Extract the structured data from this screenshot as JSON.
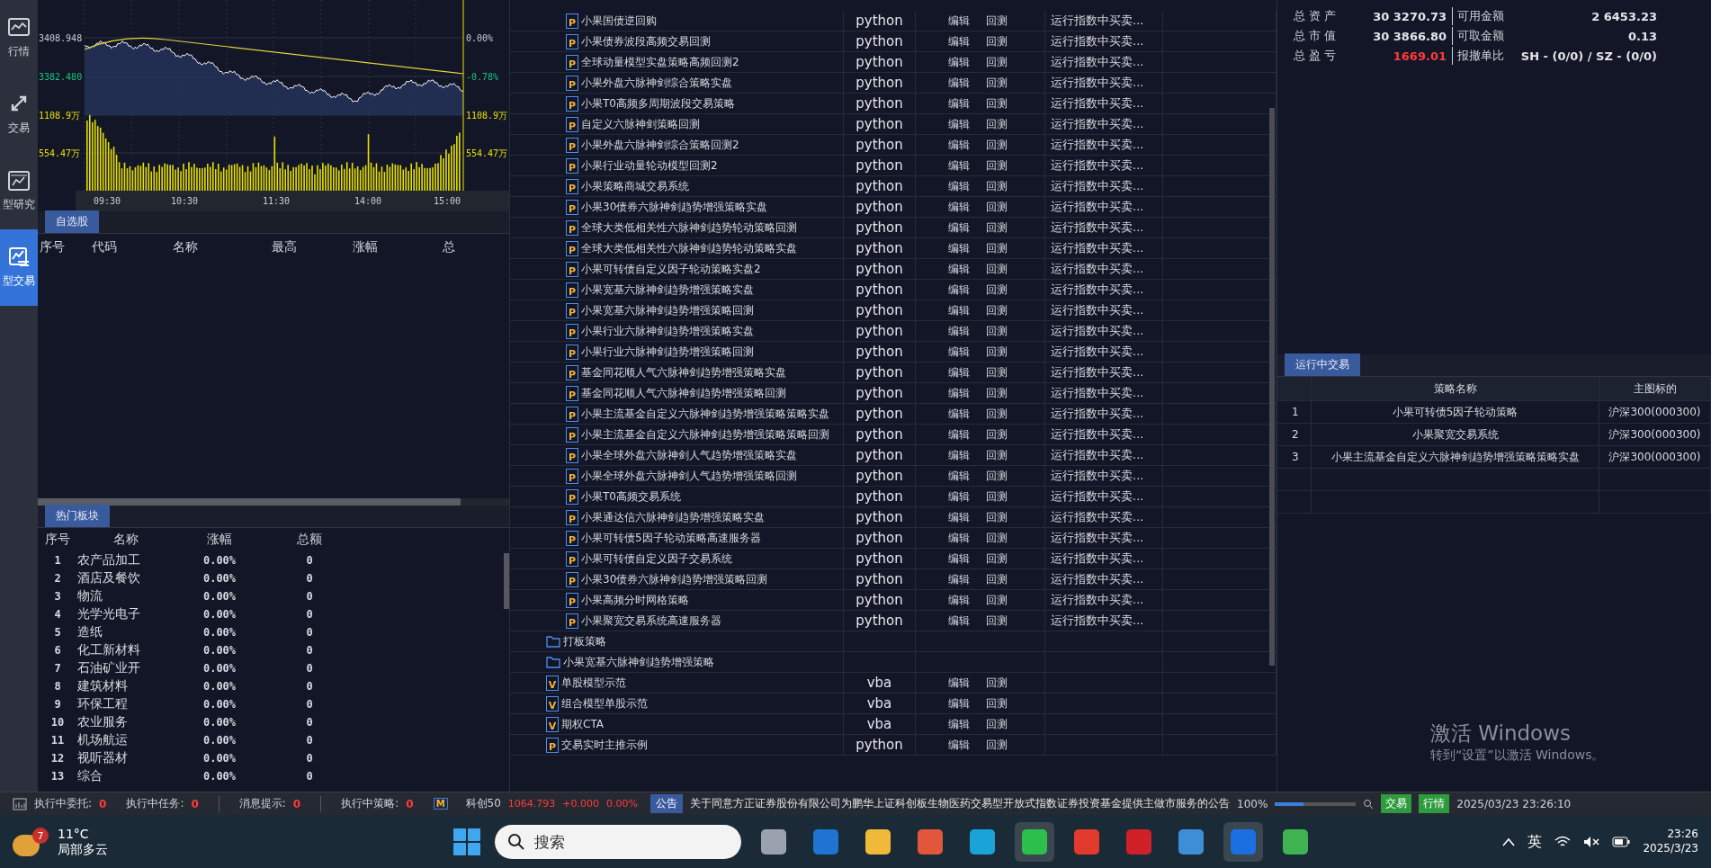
{
  "nav": [
    {
      "label": "行情",
      "selected": false
    },
    {
      "label": "交易",
      "selected": false
    },
    {
      "label": "型研究",
      "selected": false
    },
    {
      "label": "型交易",
      "selected": true
    }
  ],
  "index_chart": {
    "left_ticks": [
      "3408.948",
      "3382.480",
      "1108.9万",
      "554.47万"
    ],
    "right_ticks": [
      "0.00%",
      "-0.78%",
      "1108.9万",
      "554.47万"
    ],
    "times": [
      "09:30",
      "10:30",
      "11:30",
      "14:00",
      "15:00"
    ]
  },
  "watchlist": {
    "tab": "自选股",
    "columns": [
      "序号",
      "代码",
      "名称",
      "最高",
      "涨幅",
      "总"
    ]
  },
  "hot_sectors": {
    "tab": "热门板块",
    "columns": [
      "序号",
      "名称",
      "涨幅",
      "总额"
    ],
    "rows": [
      {
        "no": "1",
        "name": "农产品加工",
        "change": "0.00%",
        "total": "0"
      },
      {
        "no": "2",
        "name": "酒店及餐饮",
        "change": "0.00%",
        "total": "0"
      },
      {
        "no": "3",
        "name": "物流",
        "change": "0.00%",
        "total": "0"
      },
      {
        "no": "4",
        "name": "光学光电子",
        "change": "0.00%",
        "total": "0"
      },
      {
        "no": "5",
        "name": "造纸",
        "change": "0.00%",
        "total": "0"
      },
      {
        "no": "6",
        "name": "化工新材料",
        "change": "0.00%",
        "total": "0"
      },
      {
        "no": "7",
        "name": "石油矿业开",
        "change": "0.00%",
        "total": "0"
      },
      {
        "no": "8",
        "name": "建筑材料",
        "change": "0.00%",
        "total": "0"
      },
      {
        "no": "9",
        "name": "环保工程",
        "change": "0.00%",
        "total": "0"
      },
      {
        "no": "10",
        "name": "农业服务",
        "change": "0.00%",
        "total": "0"
      },
      {
        "no": "11",
        "name": "机场航运",
        "change": "0.00%",
        "total": "0"
      },
      {
        "no": "12",
        "name": "视听器材",
        "change": "0.00%",
        "total": "0"
      },
      {
        "no": "13",
        "name": "综合",
        "change": "0.00%",
        "total": "0"
      }
    ]
  },
  "strategies": [
    {
      "kind": "group",
      "children": [
        {
          "kind": "script",
          "badge": "P",
          "name": "小果国债逆回购",
          "lang": "python",
          "actions": [
            "编辑",
            "回测"
          ],
          "status": "运行指数中买卖..."
        },
        {
          "kind": "script",
          "badge": "P",
          "name": "小果债券波段高频交易回测",
          "lang": "python",
          "actions": [
            "编辑",
            "回测"
          ],
          "status": "运行指数中买卖..."
        },
        {
          "kind": "script",
          "badge": "P",
          "name": "全球动量模型实盘策略高频回测2",
          "lang": "python",
          "actions": [
            "编辑",
            "回测"
          ],
          "status": "运行指数中买卖..."
        },
        {
          "kind": "script",
          "badge": "P",
          "name": "小果外盘六脉神剑综合策略实盘",
          "lang": "python",
          "actions": [
            "编辑",
            "回测"
          ],
          "status": "运行指数中买卖..."
        },
        {
          "kind": "script",
          "badge": "P",
          "name": "小果T0高频多周期波段交易策略",
          "lang": "python",
          "actions": [
            "编辑",
            "回测"
          ],
          "status": "运行指数中买卖..."
        },
        {
          "kind": "script",
          "badge": "P",
          "name": "自定义六脉神剑策略回测",
          "lang": "python",
          "actions": [
            "编辑",
            "回测"
          ],
          "status": "运行指数中买卖..."
        },
        {
          "kind": "script",
          "badge": "P",
          "name": "小果外盘六脉神剑综合策略回测2",
          "lang": "python",
          "actions": [
            "编辑",
            "回测"
          ],
          "status": "运行指数中买卖..."
        },
        {
          "kind": "script",
          "badge": "P",
          "name": "小果行业动量轮动模型回测2",
          "lang": "python",
          "actions": [
            "编辑",
            "回测"
          ],
          "status": "运行指数中买卖..."
        },
        {
          "kind": "script",
          "badge": "P",
          "name": "小果策略商城交易系统",
          "lang": "python",
          "actions": [
            "编辑",
            "回测"
          ],
          "status": "运行指数中买卖..."
        },
        {
          "kind": "script",
          "badge": "P",
          "name": "小果30债券六脉神剑趋势增强策略实盘",
          "lang": "python",
          "actions": [
            "编辑",
            "回测"
          ],
          "status": "运行指数中买卖..."
        },
        {
          "kind": "script",
          "badge": "P",
          "name": "全球大类低相关性六脉神剑趋势轮动策略回测",
          "lang": "python",
          "actions": [
            "编辑",
            "回测"
          ],
          "status": "运行指数中买卖..."
        },
        {
          "kind": "script",
          "badge": "P",
          "name": "全球大类低相关性六脉神剑趋势轮动策略实盘",
          "lang": "python",
          "actions": [
            "编辑",
            "回测"
          ],
          "status": "运行指数中买卖..."
        },
        {
          "kind": "script",
          "badge": "P",
          "name": "小果可转债自定义因子轮动策略实盘2",
          "lang": "python",
          "actions": [
            "编辑",
            "回测"
          ],
          "status": "运行指数中买卖..."
        },
        {
          "kind": "script",
          "badge": "P",
          "name": "小果宽基六脉神剑趋势增强策略实盘",
          "lang": "python",
          "actions": [
            "编辑",
            "回测"
          ],
          "status": "运行指数中买卖..."
        },
        {
          "kind": "script",
          "badge": "P",
          "name": "小果宽基六脉神剑趋势增强策略回测",
          "lang": "python",
          "actions": [
            "编辑",
            "回测"
          ],
          "status": "运行指数中买卖..."
        },
        {
          "kind": "script",
          "badge": "P",
          "name": "小果行业六脉神剑趋势增强策略实盘",
          "lang": "python",
          "actions": [
            "编辑",
            "回测"
          ],
          "status": "运行指数中买卖..."
        },
        {
          "kind": "script",
          "badge": "P",
          "name": "小果行业六脉神剑趋势增强策略回测",
          "lang": "python",
          "actions": [
            "编辑",
            "回测"
          ],
          "status": "运行指数中买卖..."
        },
        {
          "kind": "script",
          "badge": "P",
          "name": "基金同花顺人气六脉神剑趋势增强策略实盘",
          "lang": "python",
          "actions": [
            "编辑",
            "回测"
          ],
          "status": "运行指数中买卖..."
        },
        {
          "kind": "script",
          "badge": "P",
          "name": "基金同花顺人气六脉神剑趋势增强策略回测",
          "lang": "python",
          "actions": [
            "编辑",
            "回测"
          ],
          "status": "运行指数中买卖..."
        },
        {
          "kind": "script",
          "badge": "P",
          "name": "小果主流基金自定义六脉神剑趋势增强策略策略实盘",
          "lang": "python",
          "actions": [
            "编辑",
            "回测"
          ],
          "status": "运行指数中买卖..."
        },
        {
          "kind": "script",
          "badge": "P",
          "name": "小果主流基金自定义六脉神剑趋势增强策略策略回测",
          "lang": "python",
          "actions": [
            "编辑",
            "回测"
          ],
          "status": "运行指数中买卖..."
        },
        {
          "kind": "script",
          "badge": "P",
          "name": "小果全球外盘六脉神剑人气趋势增强策略实盘",
          "lang": "python",
          "actions": [
            "编辑",
            "回测"
          ],
          "status": "运行指数中买卖..."
        },
        {
          "kind": "script",
          "badge": "P",
          "name": "小果全球外盘六脉神剑人气趋势增强策略回测",
          "lang": "python",
          "actions": [
            "编辑",
            "回测"
          ],
          "status": "运行指数中买卖..."
        },
        {
          "kind": "script",
          "badge": "P",
          "name": "小果T0高频交易系统",
          "lang": "python",
          "actions": [
            "编辑",
            "回测"
          ],
          "status": "运行指数中买卖..."
        },
        {
          "kind": "script",
          "badge": "P",
          "name": "小果通达信六脉神剑趋势增强策略实盘",
          "lang": "python",
          "actions": [
            "编辑",
            "回测"
          ],
          "status": "运行指数中买卖..."
        },
        {
          "kind": "script",
          "badge": "P",
          "name": "小果可转债5因子轮动策略高速服务器",
          "lang": "python",
          "actions": [
            "编辑",
            "回测"
          ],
          "status": "运行指数中买卖..."
        },
        {
          "kind": "script",
          "badge": "P",
          "name": "小果可转债自定义因子交易系统",
          "lang": "python",
          "actions": [
            "编辑",
            "回测"
          ],
          "status": "运行指数中买卖..."
        },
        {
          "kind": "script",
          "badge": "P",
          "name": "小果30债券六脉神剑趋势增强策略回测",
          "lang": "python",
          "actions": [
            "编辑",
            "回测"
          ],
          "status": "运行指数中买卖..."
        },
        {
          "kind": "script",
          "badge": "P",
          "name": "小果高频分时网格策略",
          "lang": "python",
          "actions": [
            "编辑",
            "回测"
          ],
          "status": "运行指数中买卖..."
        },
        {
          "kind": "script",
          "badge": "P",
          "name": "小果聚宽交易系统高速服务器",
          "lang": "python",
          "actions": [
            "编辑",
            "回测"
          ],
          "status": "运行指数中买卖..."
        }
      ]
    },
    {
      "kind": "folder",
      "name": "打板策略"
    },
    {
      "kind": "folder",
      "name": "小果宽基六脉神剑趋势增强策略"
    },
    {
      "kind": "script",
      "badge": "V",
      "name": "单股模型示范",
      "lang": "vba",
      "actions": [
        "编辑",
        "回测"
      ]
    },
    {
      "kind": "script",
      "badge": "V",
      "name": "组合模型单股示范",
      "lang": "vba",
      "actions": [
        "编辑",
        "回测"
      ]
    },
    {
      "kind": "script",
      "badge": "V",
      "name": "期权CTA",
      "lang": "vba",
      "actions": [
        "编辑",
        "回测"
      ]
    },
    {
      "kind": "script",
      "badge": "P",
      "name": "交易实时主推示例",
      "lang": "python",
      "actions": [
        "编辑",
        "回测"
      ]
    }
  ],
  "account": [
    {
      "label": "总 资 产",
      "value": "30 3270.73",
      "color": "#e3e5ea",
      "label2": "可用金额",
      "value2": "2 6453.23"
    },
    {
      "label": "总 市 值",
      "value": "30 3866.80",
      "color": "#e3e5ea",
      "label2": "可取金额",
      "value2": "0.13"
    },
    {
      "label": "总 盈 亏",
      "value": "1669.01",
      "color": "#ff3b3b",
      "label2": "报撤单比",
      "value2": "SH - (0/0) / SZ - (0/0)"
    }
  ],
  "running": {
    "tab": "运行中交易",
    "columns": [
      "策略名称",
      "主图标的"
    ],
    "rows": [
      {
        "no": "1",
        "name": "小果可转债5因子轮动策略",
        "target": "沪深300(000300)"
      },
      {
        "no": "2",
        "name": "小果聚宽交易系统",
        "target": "沪深300(000300)"
      },
      {
        "no": "3",
        "name": "小果主流基金自定义六脉神剑趋势增强策略策略实盘",
        "target": "沪深300(000300)"
      }
    ]
  },
  "activation": {
    "title": "激活 Windows",
    "hint": "转到“设置”以激活 Windows。"
  },
  "status_bar": {
    "counters": [
      {
        "label": "执行中委托:",
        "value": "0"
      },
      {
        "label": "执行中任务:",
        "value": "0"
      },
      {
        "label": "消息提示:",
        "value": "0"
      },
      {
        "label": "执行中策略:",
        "value": "0"
      }
    ],
    "ticker": {
      "name": "科创50",
      "price": "1064.793",
      "change": "+0.000",
      "pct": "0.00%"
    },
    "notice_tag": "公告",
    "notice": "关于同意方正证券股份有限公司为鹏华上证科创板生物医药交易型开放式指数证券投资基金提供主做市服务的公告",
    "model_badge": "M",
    "zoom": "100%",
    "zoom_slider": {
      "level": 0.35
    },
    "modes": [
      "交易",
      "行情"
    ],
    "datetime": "2025/03/23 23:26:10"
  },
  "taskbar": {
    "weather": {
      "temp": "11°C",
      "desc": "局部多云",
      "badge": "7"
    },
    "search": "搜索",
    "apps": [
      {
        "active": false
      },
      {
        "active": false
      },
      {
        "active": false
      },
      {
        "active": false
      },
      {
        "active": false
      },
      {
        "active": true
      },
      {
        "active": false
      },
      {
        "active": false
      },
      {
        "active": false
      },
      {
        "active": true
      },
      {
        "active": false
      }
    ],
    "ime": "英",
    "time": "23:26",
    "date": "2025/3/23"
  }
}
